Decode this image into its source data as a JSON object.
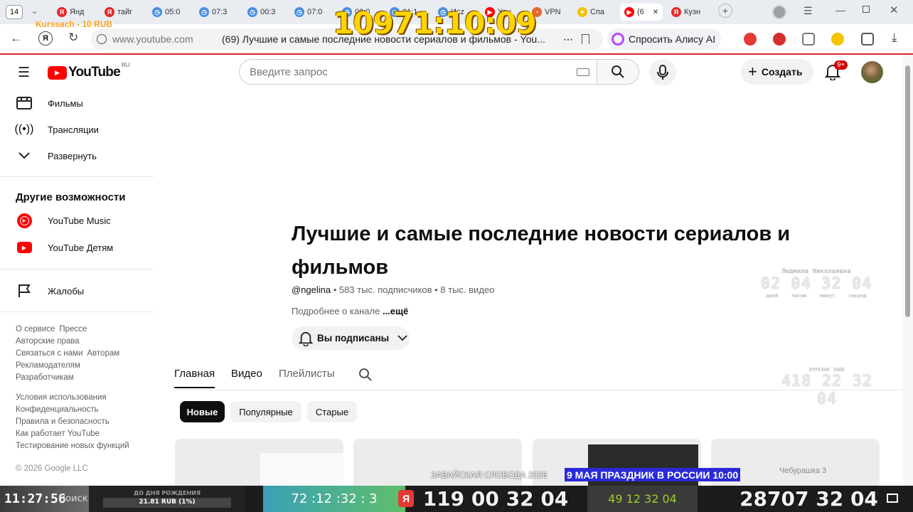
{
  "browser": {
    "tab_count": "14",
    "tabs": [
      {
        "label": "Янд",
        "fav": "Я",
        "color": "#e42b2b"
      },
      {
        "label": "тайг",
        "fav": "Я",
        "color": "#e42b2b"
      },
      {
        "label": "05:0",
        "fav": "◷",
        "color": "#4a8fe0"
      },
      {
        "label": "07:3",
        "fav": "◷",
        "color": "#4a8fe0"
      },
      {
        "label": "00:3",
        "fav": "◷",
        "color": "#4a8fe0"
      },
      {
        "label": "07:0",
        "fav": "◷",
        "color": "#4a8fe0"
      },
      {
        "label": "02:0",
        "fav": "◷",
        "color": "#4a8fe0"
      },
      {
        "label": "01:1",
        "fav": "◷",
        "color": "#4a8fe0"
      },
      {
        "label": "Иcz",
        "fav": "◷",
        "color": "#4a8fe0"
      },
      {
        "label": "You",
        "fav": "▶",
        "color": "#ff0000"
      },
      {
        "label": "VPN",
        "fav": "◔",
        "color": "#e46a2b"
      },
      {
        "label": "Спа",
        "fav": "✦",
        "color": "#f2c500"
      },
      {
        "label": "(6",
        "fav": "▶",
        "color": "#ff0000"
      },
      {
        "label": "Кузн",
        "fav": "Я",
        "color": "#e42b2b"
      }
    ],
    "new_tab_symbol": "+",
    "url": "www.youtube.com",
    "page_title": "(69) Лучшие и самые последние новости сериалов и фильмов - You...",
    "ask_alice": "Спросить Алису AI"
  },
  "youtube": {
    "logo_text": "YouTube",
    "logo_region": "RU",
    "search_placeholder": "Введите запрос",
    "create_label": "Создать",
    "notifications_badge": "9+",
    "sidebar": {
      "items_top": [
        {
          "label": "Фильмы",
          "icon": "film-icon"
        },
        {
          "label": "Трансляции",
          "icon": "live-icon"
        },
        {
          "label": "Развернуть",
          "icon": "chevron-down-icon"
        }
      ],
      "section_title": "Другие возможности",
      "items_more": [
        {
          "label": "YouTube Music",
          "icon": "youtube-music-icon"
        },
        {
          "label": "YouTube Детям",
          "icon": "youtube-kids-icon"
        }
      ],
      "report_label": "Жалобы",
      "footer_links_1": [
        "О сервисе",
        "Прессе",
        "Авторские права",
        "Связаться с нами",
        "Авторам",
        "Рекламодателям",
        "Разработчикам"
      ],
      "footer_links_2": [
        "Условия использования",
        "Конфиденциальность",
        "Правила и безопасность",
        "Как работает YouTube",
        "Тестирование новых функций"
      ],
      "copyright": "© 2026 Google LLC"
    },
    "channel": {
      "title": "Лучшие и самые последние новости сериалов и фильмов",
      "handle": "@ngelina",
      "subscribers": "583 тыс. подписчиков",
      "videos": "8 тыс. видео",
      "about_prefix": "Подробнее о канале",
      "about_more": "...ещё",
      "subscribed_label": "Вы подписаны",
      "tabs": [
        "Главная",
        "Видео",
        "Плейлисты"
      ],
      "chips": [
        "Новые",
        "Популярные",
        "Старые"
      ]
    }
  },
  "overlays": {
    "stream_title": "Kurssach - 10 RUB",
    "big_counter": "10971:10:09",
    "clock1_title": "Людмила Николаевна",
    "clock1": "02 04 32 04",
    "clock1_units": [
      "дней",
      "часов",
      "минут",
      "секунд"
    ],
    "clock2_title": "ОТРЕЗОК ЗАВЕ",
    "clock2": "418 22 32 04",
    "ticker_left": "ЗАВАЙСКАЯ СЛОБОДА 2026",
    "ticker_right": "9 МАЯ ПРАЗДНИК В РОССИИ 10:00",
    "ticker_far": "Чебурашка 3",
    "bottom_time": "11:27:56",
    "bottom_search": "Поиск",
    "bottom_rub": "21.81 RUB (1%)",
    "bottom_small_caption": "ДО ДНЯ РОЖДЕНИЯ",
    "bottom_counter1": "72 :12 :32 : 3",
    "bottom_counter2": "119 00 32 04",
    "bottom_counter3": "49  12  32  04",
    "bottom_counter4": "28707 32 04"
  }
}
